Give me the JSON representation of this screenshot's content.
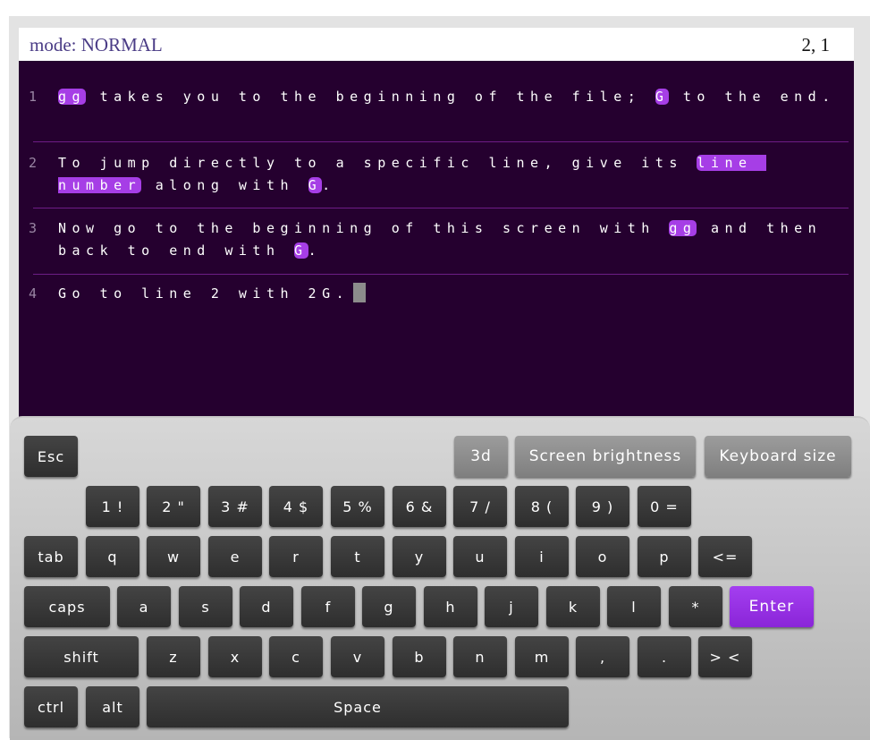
{
  "status": {
    "mode": "mode: NORMAL",
    "position": "2, 1"
  },
  "editor": {
    "lines": [
      {
        "number": "1",
        "segments": [
          {
            "text": "gg",
            "hl": true
          },
          {
            "text": " takes you to the beginning of the file; ",
            "hl": false
          },
          {
            "text": "G",
            "hl": true
          },
          {
            "text": " to the end.",
            "hl": false
          }
        ]
      },
      {
        "number": "2",
        "segments": [
          {
            "text": "To jump directly to a specific line, give its ",
            "hl": false
          },
          {
            "text": "line number",
            "hl": true
          },
          {
            "text": " along with ",
            "hl": false
          },
          {
            "text": "G",
            "hl": true
          },
          {
            "text": ".",
            "hl": false
          }
        ]
      },
      {
        "number": "3",
        "segments": [
          {
            "text": "Now go to the beginning of this screen with ",
            "hl": false
          },
          {
            "text": "gg",
            "hl": true
          },
          {
            "text": " and then back to end with ",
            "hl": false
          },
          {
            "text": "G",
            "hl": true
          },
          {
            "text": ".",
            "hl": false
          }
        ]
      },
      {
        "number": "4",
        "segments": [
          {
            "text": "Go to line 2 with 2G.",
            "hl": false
          }
        ]
      }
    ]
  },
  "keyboard": {
    "esc": "Esc",
    "three_d": "3d",
    "brightness": "Screen brightness",
    "size": "Keyboard size",
    "digits": [
      "1 !",
      "2 \"",
      "3 #",
      "4 $",
      "5 %",
      "6 &",
      "7 /",
      "8 (",
      "9 )",
      "0 ="
    ],
    "tab": "tab",
    "row_q": [
      "q",
      "w",
      "e",
      "r",
      "t",
      "y",
      "u",
      "i",
      "o",
      "p"
    ],
    "backspace": "<=",
    "caps": "caps",
    "row_a": [
      "a",
      "s",
      "d",
      "f",
      "g",
      "h",
      "j",
      "k",
      "l",
      "*"
    ],
    "enter": "Enter",
    "shift": "shift",
    "row_z": [
      "z",
      "x",
      "c",
      "v",
      "b",
      "n",
      "m",
      ",",
      "."
    ],
    "angle": "> <",
    "ctrl": "ctrl",
    "alt": "alt",
    "space": "Space"
  }
}
